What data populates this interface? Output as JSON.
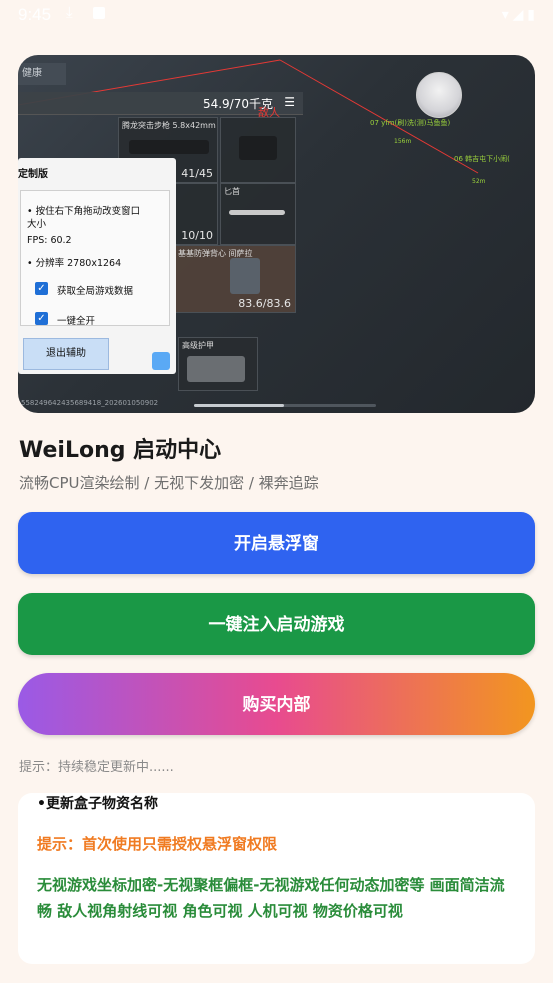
{
  "status_bar": {
    "time": "9:45"
  },
  "banner": {
    "health_label": "健康",
    "weight": "54.9/70千克",
    "danger_label": "敌人",
    "slots": [
      {
        "caption": "腾龙突击步枪\n5.8x42mm",
        "count": "41/45"
      },
      {
        "caption": "",
        "count": ""
      },
      {
        "caption": "",
        "count": "10/10"
      },
      {
        "caption": "匕首",
        "count": ""
      },
      {
        "caption": "基基防弹背心\n间萨拉",
        "count": "83.6/83.6"
      },
      {
        "caption": "高级护甲",
        "count": ""
      }
    ],
    "enemies": [
      {
        "label": "07 yfm(刷)洗(测)马鱼鱼)",
        "distance": "156m"
      },
      {
        "label": "06 韩吉屯下小闹(",
        "distance": "52m"
      }
    ],
    "panel": {
      "title": "定制版",
      "line1": "• 按住右下角拖动改变窗口",
      "line2": "大小",
      "fps": "FPS: 60.2",
      "resolution": "• 分辨率 2780x1264",
      "check1": "获取全局游戏数据",
      "check2": "一键全开",
      "exit_button": "退出辅助"
    },
    "id_text": "5582496424356894​18_2026010​50902"
  },
  "app": {
    "title": "WeiLong 启动中心",
    "subtitle": "流畅CPU渲染绘制 / 无视下发加密 / 裸奔追踪"
  },
  "buttons": {
    "float": "开启悬浮窗",
    "inject": "一键注入启动游戏",
    "buy": "购买内部"
  },
  "hint": "提示：持续稳定更新中......",
  "card": {
    "line1": "•更新盒子物资名称",
    "line2": "提示：首次使用只需授权悬浮窗权限",
    "line3": "无视游戏坐标加密-无视聚框偏框-无视游戏任何动态加密等 画面简洁流畅 敌人视角射线可视 角色可视 人机可视 物资价格可视"
  },
  "colors": {
    "background": "#fdf5ef",
    "float_button": "#2f63f0",
    "inject_button": "#1a9846",
    "buy_gradient": [
      "#9a5ae6",
      "#e84b8f",
      "#f2961f"
    ],
    "hint_orange": "#f07b22",
    "feature_green": "#2a8c3a"
  }
}
